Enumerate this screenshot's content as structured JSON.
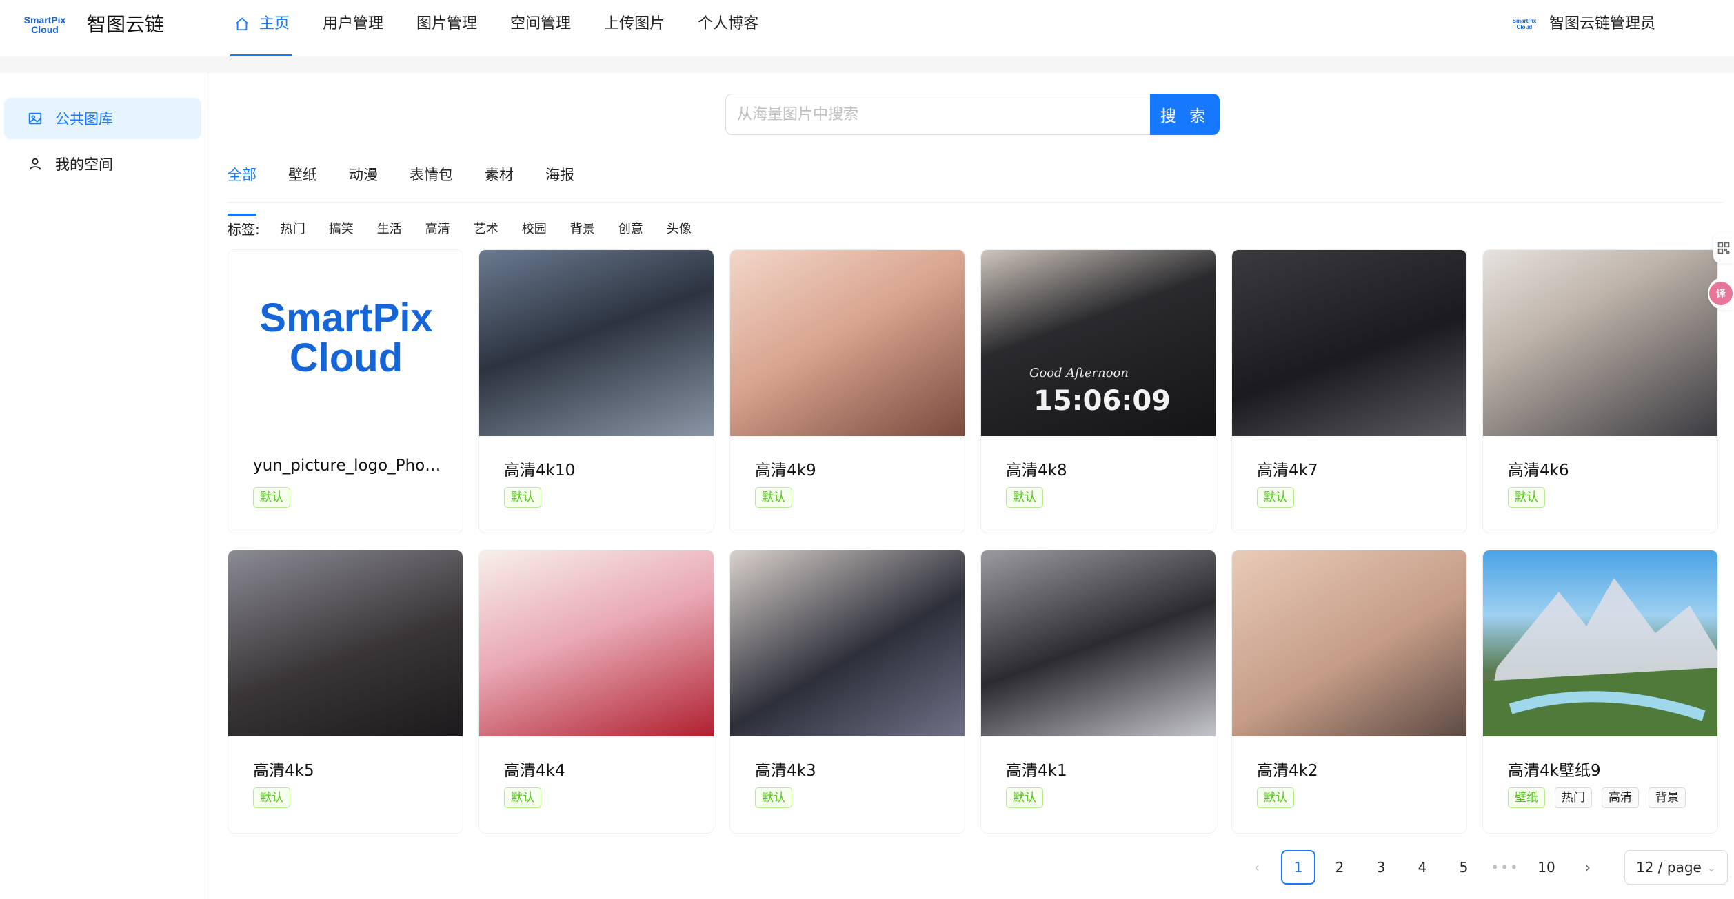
{
  "header": {
    "logo_line1": "SmartPix",
    "logo_line2": "Cloud",
    "brand": "智图云链",
    "nav": [
      "主页",
      "用户管理",
      "图片管理",
      "空间管理",
      "上传图片",
      "个人博客"
    ],
    "user_name": "智图云链管理员"
  },
  "sidebar": {
    "items": [
      "公共图库",
      "我的空间"
    ]
  },
  "search": {
    "placeholder": "从海量图片中搜索",
    "button": "搜 索"
  },
  "categories": [
    "全部",
    "壁纸",
    "动漫",
    "表情包",
    "素材",
    "海报"
  ],
  "tags": {
    "label": "标签:",
    "items": [
      "热门",
      "搞笑",
      "生活",
      "高清",
      "艺术",
      "校园",
      "背景",
      "创意",
      "头像"
    ]
  },
  "cards": [
    {
      "title": "yun_picture_logo_Phot...",
      "tags": [
        "默认"
      ],
      "image": "logo"
    },
    {
      "title": "高清4k10",
      "tags": [
        "默认"
      ],
      "image": "photo"
    },
    {
      "title": "高清4k9",
      "tags": [
        "默认"
      ],
      "image": "photo"
    },
    {
      "title": "高清4k8",
      "tags": [
        "默认"
      ],
      "image": "photo"
    },
    {
      "title": "高清4k7",
      "tags": [
        "默认"
      ],
      "image": "photo"
    },
    {
      "title": "高清4k6",
      "tags": [
        "默认"
      ],
      "image": "photo"
    },
    {
      "title": "高清4k5",
      "tags": [
        "默认"
      ],
      "image": "photo"
    },
    {
      "title": "高清4k4",
      "tags": [
        "默认"
      ],
      "image": "photo"
    },
    {
      "title": "高清4k3",
      "tags": [
        "默认"
      ],
      "image": "photo"
    },
    {
      "title": "高清4k1",
      "tags": [
        "默认"
      ],
      "image": "photo"
    },
    {
      "title": "高清4k2",
      "tags": [
        "默认"
      ],
      "image": "photo"
    },
    {
      "title": "高清4k壁纸9",
      "tags": [
        "壁纸",
        "热门",
        "高清",
        "背景"
      ],
      "image": "landscape"
    }
  ],
  "card_image_text": {
    "logo_line1": "SmartPix",
    "logo_line2": "Cloud",
    "watch_text": "15:06:09",
    "watch_script": "Good Afternoon"
  },
  "pagination": {
    "pages": [
      "1",
      "2",
      "3",
      "4",
      "5",
      "•••",
      "10"
    ],
    "current": "1",
    "page_size": "12 / page"
  },
  "colors": {
    "primary": "#1677ff",
    "tag_green": "#52c41a"
  },
  "icons": {
    "home": "home-icon",
    "gallery": "picture-icon",
    "space": "user-icon",
    "qr": "qrcode-icon",
    "translate": "translate-icon"
  }
}
